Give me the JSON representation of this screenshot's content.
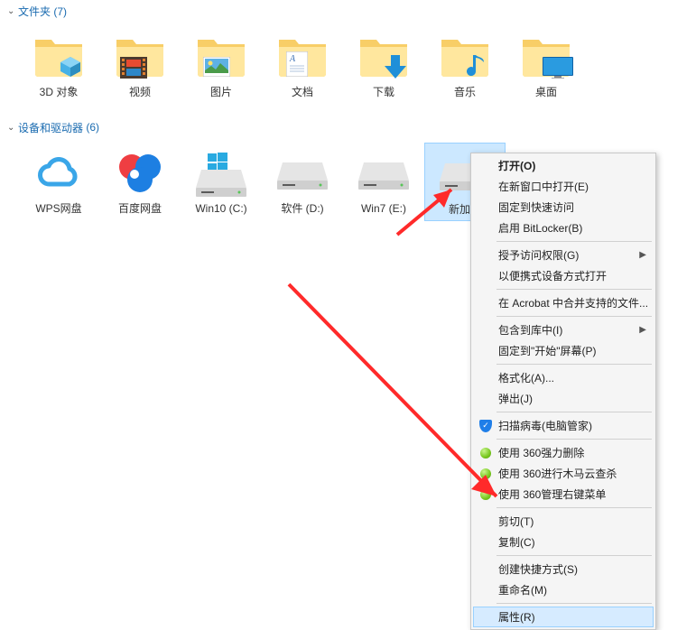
{
  "sections": {
    "folders": {
      "title": "文件夹",
      "count": 7
    },
    "devices": {
      "title": "设备和驱动器",
      "count": 6
    }
  },
  "folders": [
    {
      "label": "3D 对象"
    },
    {
      "label": "视频"
    },
    {
      "label": "图片"
    },
    {
      "label": "文档"
    },
    {
      "label": "下载"
    },
    {
      "label": "音乐"
    },
    {
      "label": "桌面"
    }
  ],
  "devices": [
    {
      "label": "WPS网盘"
    },
    {
      "label": "百度网盘"
    },
    {
      "label": "Win10 (C:)"
    },
    {
      "label": "软件 (D:)"
    },
    {
      "label": "Win7 (E:)"
    },
    {
      "label": "新加卷"
    }
  ],
  "context_menu": {
    "groups": [
      [
        {
          "label": "打开(O)",
          "bold": true
        },
        {
          "label": "在新窗口中打开(E)"
        },
        {
          "label": "固定到快速访问"
        },
        {
          "label": "启用 BitLocker(B)"
        }
      ],
      [
        {
          "label": "授予访问权限(G)",
          "submenu": true
        },
        {
          "label": "以便携式设备方式打开"
        }
      ],
      [
        {
          "label": "在 Acrobat 中合并支持的文件..."
        }
      ],
      [
        {
          "label": "包含到库中(I)",
          "submenu": true
        },
        {
          "label": "固定到\"开始\"屏幕(P)"
        }
      ],
      [
        {
          "label": "格式化(A)..."
        },
        {
          "label": "弹出(J)"
        }
      ],
      [
        {
          "label": "扫描病毒(电脑管家)",
          "icon": "shield"
        }
      ],
      [
        {
          "label": "使用 360强力删除",
          "icon": "orb"
        },
        {
          "label": "使用 360进行木马云查杀",
          "icon": "orb"
        },
        {
          "label": "使用 360管理右键菜单",
          "icon": "orb"
        }
      ],
      [
        {
          "label": "剪切(T)"
        },
        {
          "label": "复制(C)"
        }
      ],
      [
        {
          "label": "创建快捷方式(S)"
        },
        {
          "label": "重命名(M)"
        }
      ],
      [
        {
          "label": "属性(R)",
          "highlight": true
        }
      ]
    ]
  }
}
